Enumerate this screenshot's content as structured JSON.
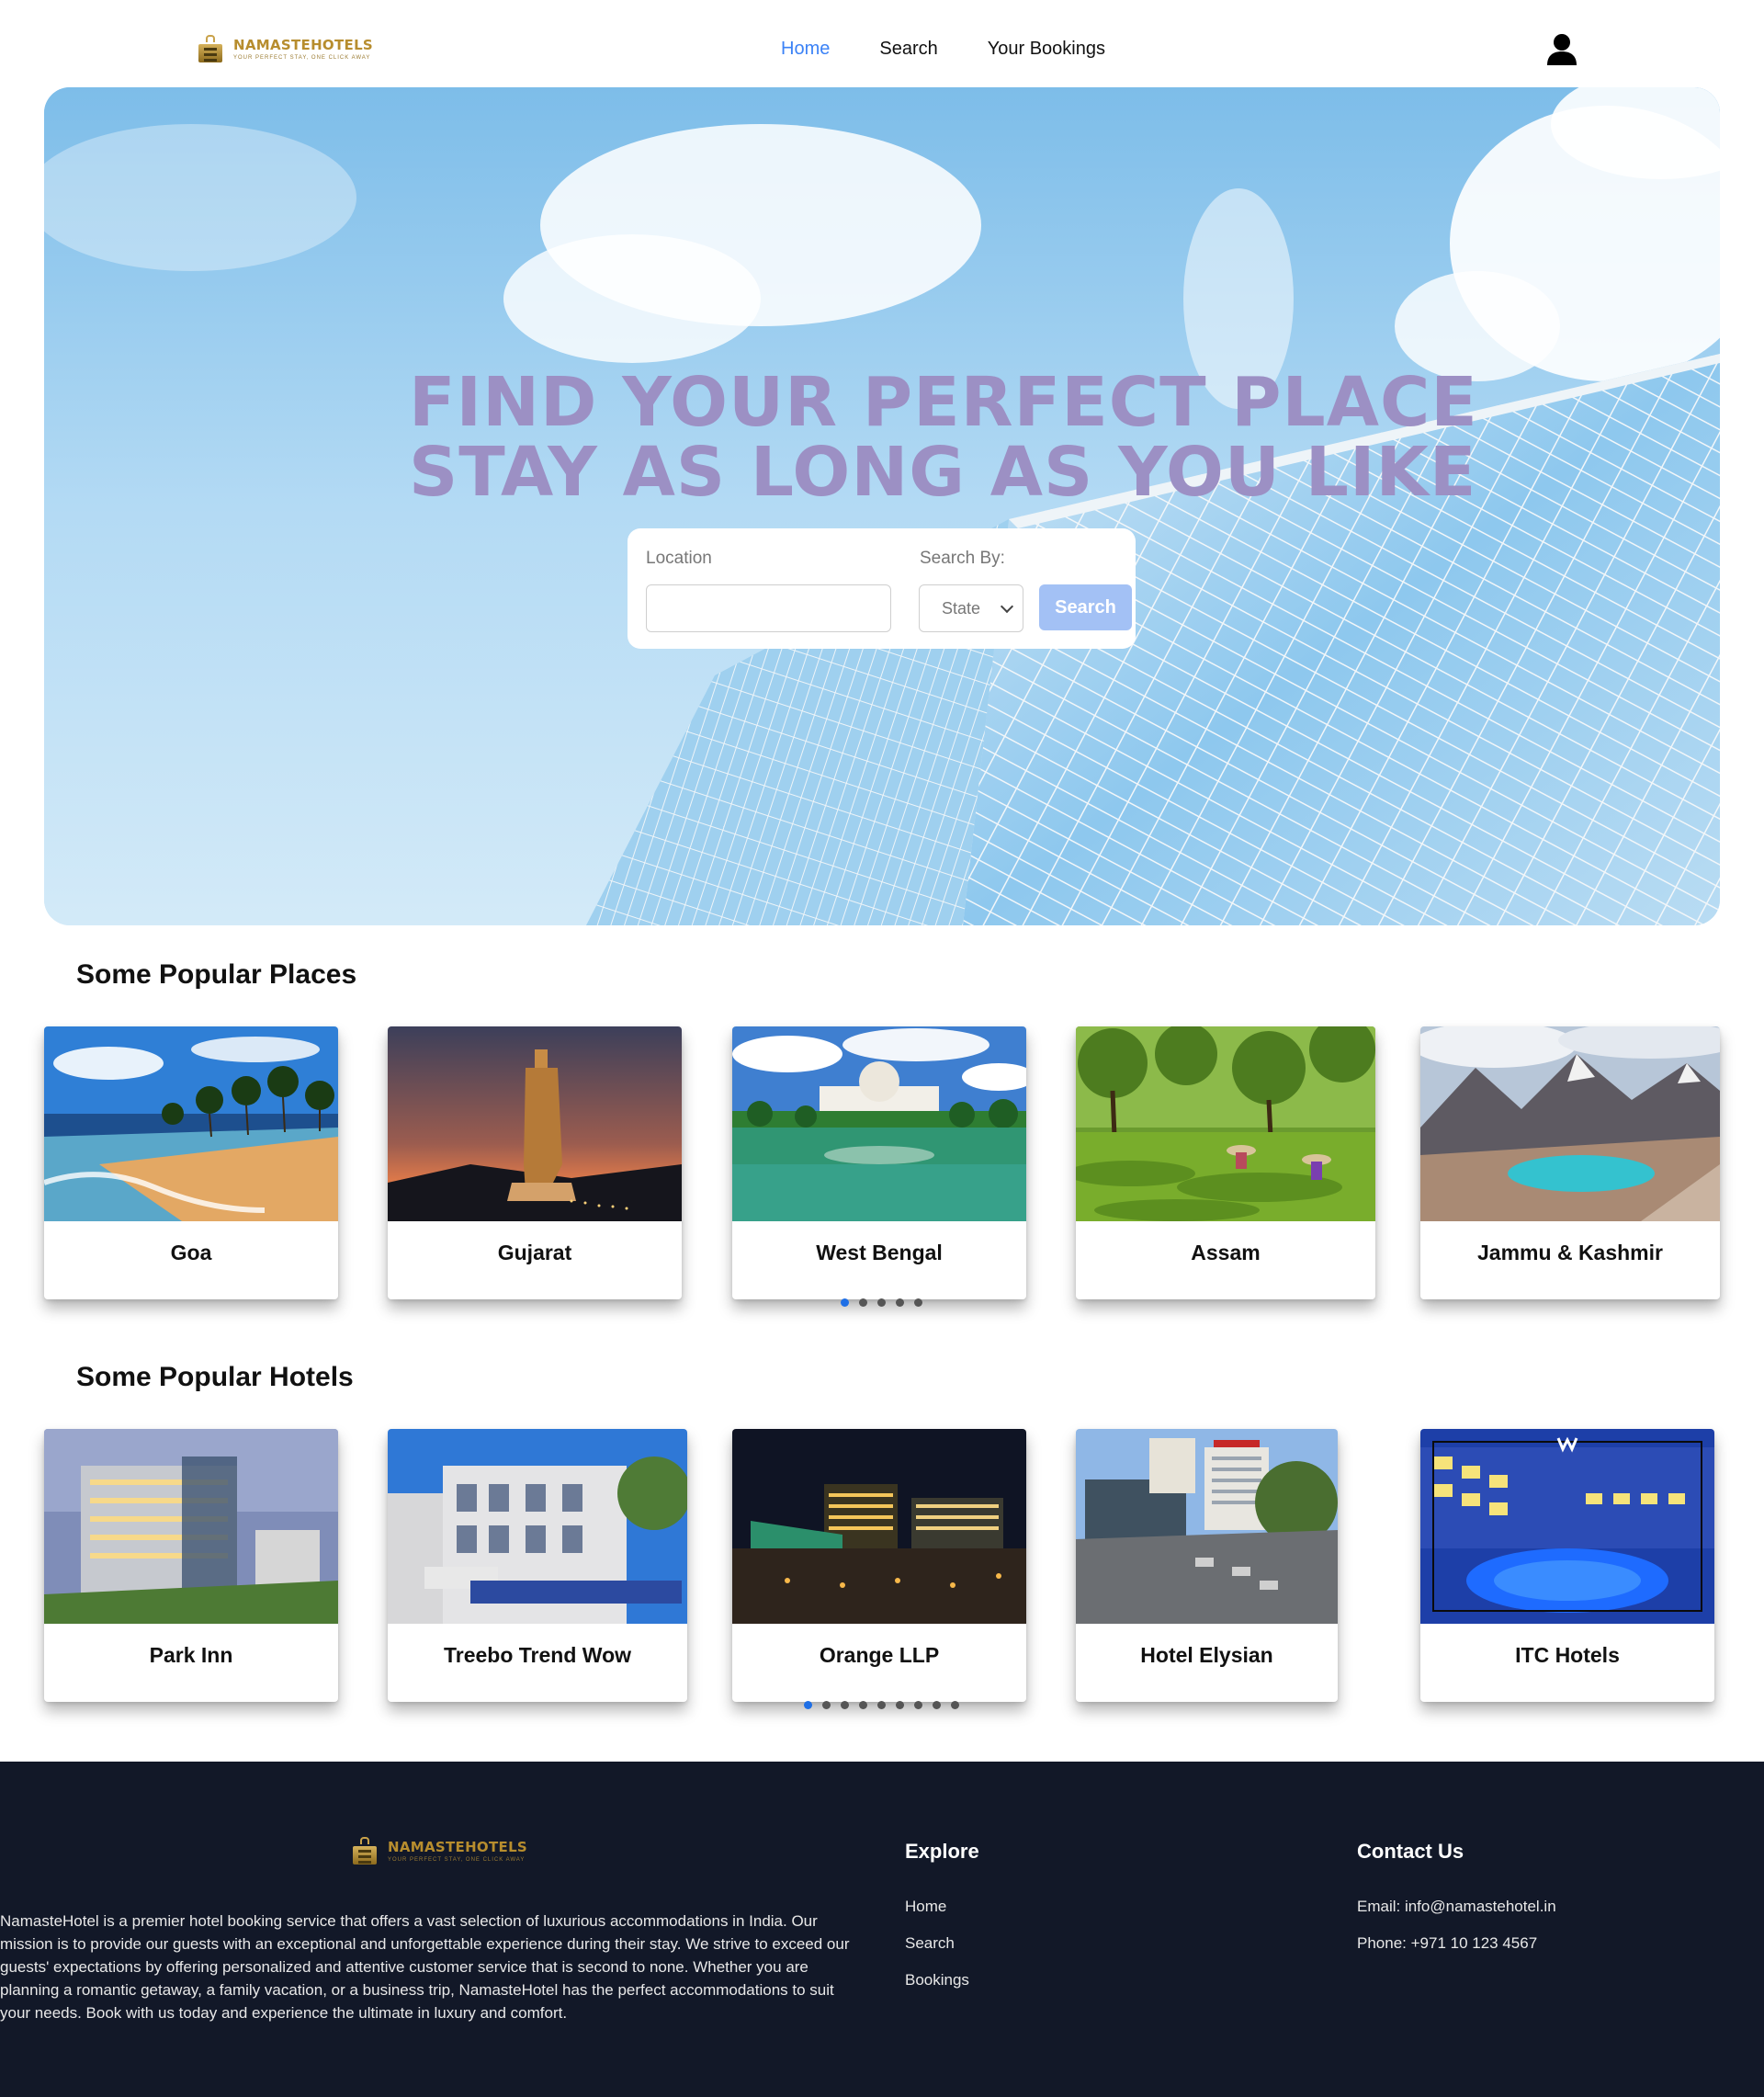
{
  "brand": {
    "name": "NAMASTEHOTELS",
    "tagline": "YOUR PERFECT STAY, ONE CLICK AWAY"
  },
  "nav": {
    "links": [
      {
        "label": "Home"
      },
      {
        "label": "Search"
      },
      {
        "label": "Your Bookings"
      }
    ],
    "active": "Home"
  },
  "hero": {
    "title_line1": "FIND YOUR PERFECT PLACE",
    "title_line2": "STAY AS LONG AS YOU LIKE",
    "location_label": "Location",
    "location_value": "",
    "search_by_label": "Search By:",
    "search_by_value": "State",
    "search_button": "Search"
  },
  "places": {
    "title": "Some Popular Places",
    "items": [
      {
        "name": "Goa"
      },
      {
        "name": "Gujarat"
      },
      {
        "name": "West Bengal"
      },
      {
        "name": "Assam"
      },
      {
        "name": "Jammu & Kashmir"
      }
    ],
    "page_count": 5,
    "active_page": 1
  },
  "hotels": {
    "title": "Some Popular Hotels",
    "items": [
      {
        "name": "Park Inn"
      },
      {
        "name": "Treebo Trend Wow"
      },
      {
        "name": "Orange LLP"
      },
      {
        "name": "Hotel Elysian"
      },
      {
        "name": "ITC Hotels"
      }
    ],
    "page_count": 9,
    "active_page": 1
  },
  "footer": {
    "description": "NamasteHotel is a premier hotel booking service that offers a vast selection of luxurious accommodations in India. Our mission is to provide our guests with an exceptional and unforgettable experience during their stay. We strive to exceed our guests' expectations by offering personalized and attentive customer service that is second to none. Whether you are planning a romantic getaway, a family vacation, or a business trip, NamasteHotel has the perfect accommodations to suit your needs. Book with us today and experience the ultimate in luxury and comfort.",
    "explore_title": "Explore",
    "explore_links": [
      {
        "label": "Home"
      },
      {
        "label": "Search"
      },
      {
        "label": "Bookings"
      }
    ],
    "contact_title": "Contact Us",
    "email": "Email: info@namastehotel.in",
    "phone": "Phone: +971 10 123 4567"
  },
  "colors": {
    "accent": "#3b82f6",
    "hero_title": "#9c90c4",
    "search_button": "#a3c1f5",
    "footer_bg": "#121828",
    "brand_gold": "#b78d2e",
    "dot_active": "#1e6fe6"
  },
  "icons": {
    "user": "user-icon",
    "select": "chevron-down-icon"
  }
}
